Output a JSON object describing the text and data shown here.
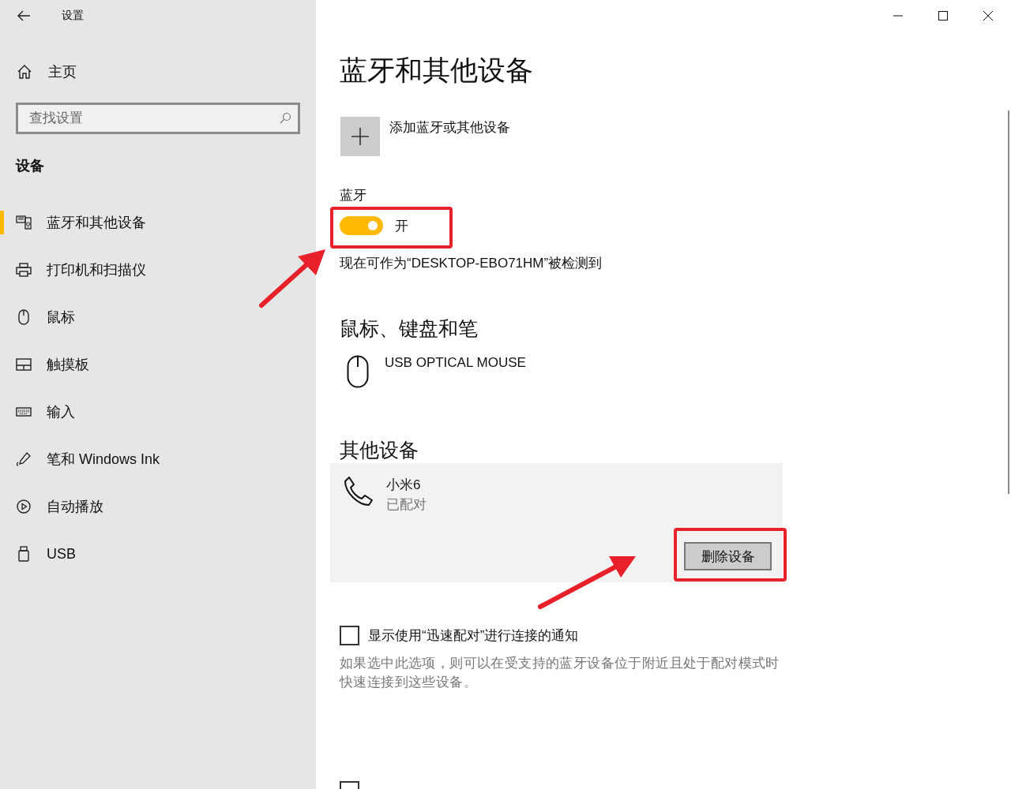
{
  "window": {
    "title": "设置"
  },
  "sidebar": {
    "home": "主页",
    "search": {
      "placeholder": "查找设置"
    },
    "section": "设备",
    "items": [
      {
        "label": "蓝牙和其他设备",
        "selected": true
      },
      {
        "label": "打印机和扫描仪",
        "selected": false
      },
      {
        "label": "鼠标",
        "selected": false
      },
      {
        "label": "触摸板",
        "selected": false
      },
      {
        "label": "输入",
        "selected": false
      },
      {
        "label": "笔和 Windows Ink",
        "selected": false
      },
      {
        "label": "自动播放",
        "selected": false
      },
      {
        "label": "USB",
        "selected": false
      }
    ]
  },
  "main": {
    "title": "蓝牙和其他设备",
    "add_device": "添加蓝牙或其他设备",
    "bluetooth": {
      "label": "蓝牙",
      "on": true,
      "state_text": "开",
      "discoverable": "现在可作为“DESKTOP-EBO71HM”被检测到"
    },
    "mouse_section": {
      "title": "鼠标、键盘和笔",
      "devices": [
        {
          "name": "USB OPTICAL MOUSE"
        }
      ]
    },
    "other_section": {
      "title": "其他设备",
      "devices": [
        {
          "name": "小米6",
          "status": "已配对",
          "expanded": true,
          "action": "删除设备"
        }
      ]
    },
    "swift_pair": {
      "checked": false,
      "label": "显示使用“迅速配对”进行连接的通知",
      "description": "如果选中此选项，则可以在受支持的蓝牙设备位于附近且处于配对模式时快速连接到这些设备。"
    },
    "metered": {
      "checked": false
    }
  }
}
